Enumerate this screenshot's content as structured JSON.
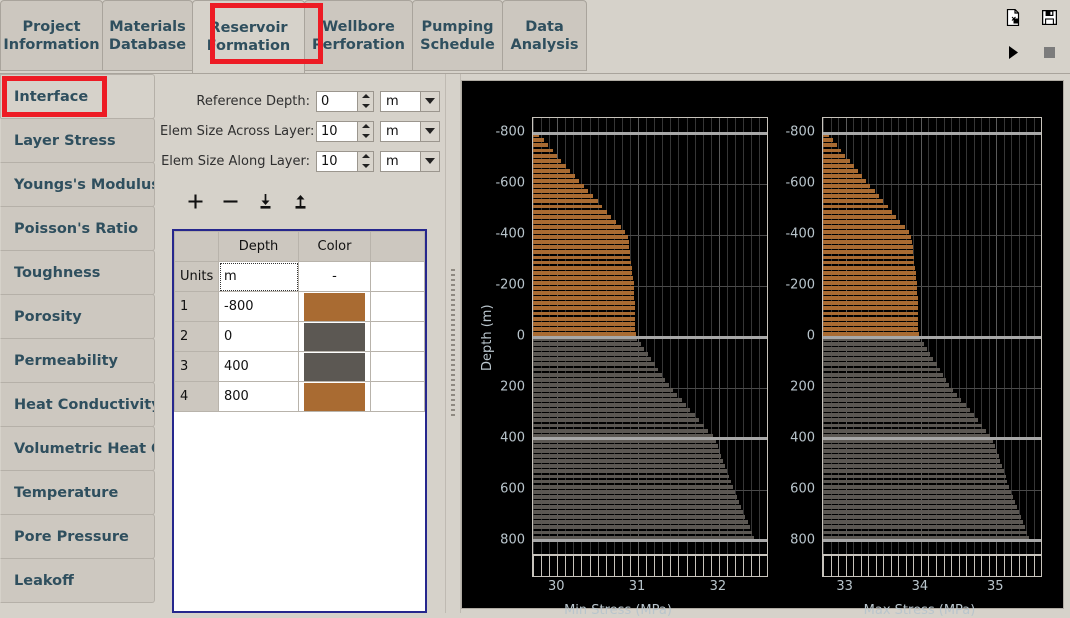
{
  "window": {
    "top_tabs": [
      {
        "id": "project-information",
        "label_line1": "Project",
        "label_line2": "Information",
        "active": false
      },
      {
        "id": "materials-database",
        "label_line1": "Materials",
        "label_line2": "Database",
        "active": false
      },
      {
        "id": "reservoir-formation",
        "label_line1": "Reservoir",
        "label_line2": "Formation",
        "active": true,
        "highlighted": true
      },
      {
        "id": "wellbore-perforation",
        "label_line1": "Wellbore",
        "label_line2": "Perforation",
        "active": false
      },
      {
        "id": "pumping-schedule",
        "label_line1": "Pumping",
        "label_line2": "Schedule",
        "active": false
      },
      {
        "id": "data-analysis",
        "label_line1": "Data",
        "label_line2": "Analysis",
        "active": false
      }
    ],
    "top_icons": [
      {
        "id": "new-document-icon",
        "name": "new-document-icon"
      },
      {
        "id": "save-icon",
        "name": "save-icon"
      },
      {
        "id": "run-icon",
        "name": "play-icon"
      },
      {
        "id": "stop-icon",
        "name": "stop-icon"
      }
    ]
  },
  "sidebar": {
    "items": [
      {
        "label": "Interface",
        "active": true,
        "highlighted": true
      },
      {
        "label": "Layer Stress",
        "active": false
      },
      {
        "label": "Youngs's Modulus",
        "active": false
      },
      {
        "label": "Poisson's Ratio",
        "active": false
      },
      {
        "label": "Toughness",
        "active": false
      },
      {
        "label": "Porosity",
        "active": false
      },
      {
        "label": "Permeability",
        "active": false
      },
      {
        "label": "Heat Conductivity",
        "active": false
      },
      {
        "label": "Volumetric Heat C",
        "active": false
      },
      {
        "label": "Temperature",
        "active": false
      },
      {
        "label": "Pore Pressure",
        "active": false
      },
      {
        "label": "Leakoff",
        "active": false
      }
    ]
  },
  "form": {
    "fields": [
      {
        "label": "Reference Depth:",
        "value": "0",
        "unit": "m"
      },
      {
        "label": "Elem Size Across Layer:",
        "value": "10",
        "unit": "m"
      },
      {
        "label": "Elem Size Along Layer:",
        "value": "10",
        "unit": "m"
      }
    ],
    "toolbar": [
      {
        "name": "add-row-button",
        "glyph": "+"
      },
      {
        "name": "remove-row-button",
        "glyph": "−"
      },
      {
        "name": "import-button",
        "glyph": "import"
      },
      {
        "name": "export-button",
        "glyph": "export"
      }
    ]
  },
  "table": {
    "headers": [
      "",
      "Depth",
      "Color"
    ],
    "units_row": {
      "label": "Units",
      "depth": "m",
      "color": "-"
    },
    "rows": [
      {
        "index": "1",
        "depth": "-800",
        "color": "#a96b32"
      },
      {
        "index": "2",
        "depth": "0",
        "color": "#5c5853"
      },
      {
        "index": "3",
        "depth": "400",
        "color": "#5c5853"
      },
      {
        "index": "4",
        "depth": "800",
        "color": "#a96b32"
      }
    ]
  },
  "chart_data": [
    {
      "type": "bar",
      "orientation": "horizontal",
      "title": "",
      "xlabel": "Min Stress (MPa)",
      "ylabel": "Depth (m)",
      "xlim": [
        29.7,
        32.62
      ],
      "ylim": [
        -860,
        860
      ],
      "y_inverted": true,
      "xticks": [
        30,
        31,
        32
      ],
      "yticks": [
        -800,
        -600,
        -400,
        -200,
        0,
        200,
        400,
        600,
        800
      ],
      "grid": true,
      "background": "#000000",
      "layer_boundaries": [
        -800,
        0,
        400,
        800
      ],
      "layer_colors": [
        "#a96b32",
        "#5c5853",
        "#5c5853"
      ],
      "profile_points": [
        {
          "depth": -800,
          "value": 29.75
        },
        {
          "depth": -600,
          "value": 30.3
        },
        {
          "depth": -400,
          "value": 30.87
        },
        {
          "depth": -200,
          "value": 30.95
        },
        {
          "depth": 0,
          "value": 30.97
        },
        {
          "depth": 200,
          "value": 31.4
        },
        {
          "depth": 400,
          "value": 31.95
        },
        {
          "depth": 600,
          "value": 32.18
        },
        {
          "depth": 800,
          "value": 32.45
        }
      ]
    },
    {
      "type": "bar",
      "orientation": "horizontal",
      "title": "",
      "xlabel": "Max Stress (MPa)",
      "ylabel": "",
      "xlim": [
        32.7,
        35.62
      ],
      "ylim": [
        -860,
        860
      ],
      "y_inverted": true,
      "xticks": [
        33,
        34,
        35
      ],
      "yticks": [
        -800,
        -600,
        -400,
        -200,
        0,
        200,
        400,
        600,
        800
      ],
      "grid": true,
      "background": "#000000",
      "layer_boundaries": [
        -800,
        0,
        400,
        800
      ],
      "layer_colors": [
        "#a96b32",
        "#5c5853",
        "#5c5853"
      ],
      "profile_points": [
        {
          "depth": -800,
          "value": 32.75
        },
        {
          "depth": -600,
          "value": 33.3
        },
        {
          "depth": -400,
          "value": 33.87
        },
        {
          "depth": -200,
          "value": 33.95
        },
        {
          "depth": 0,
          "value": 33.97
        },
        {
          "depth": 200,
          "value": 34.4
        },
        {
          "depth": 400,
          "value": 34.95
        },
        {
          "depth": 600,
          "value": 35.18
        },
        {
          "depth": 800,
          "value": 35.45
        }
      ]
    }
  ],
  "colors": {
    "accent_red": "#ed1b24",
    "panel": "#d6d2ca",
    "tab_text": "#2f4f5e",
    "table_border": "#26278d",
    "orange_layer": "#a96b32",
    "gray_layer": "#5c5853"
  }
}
